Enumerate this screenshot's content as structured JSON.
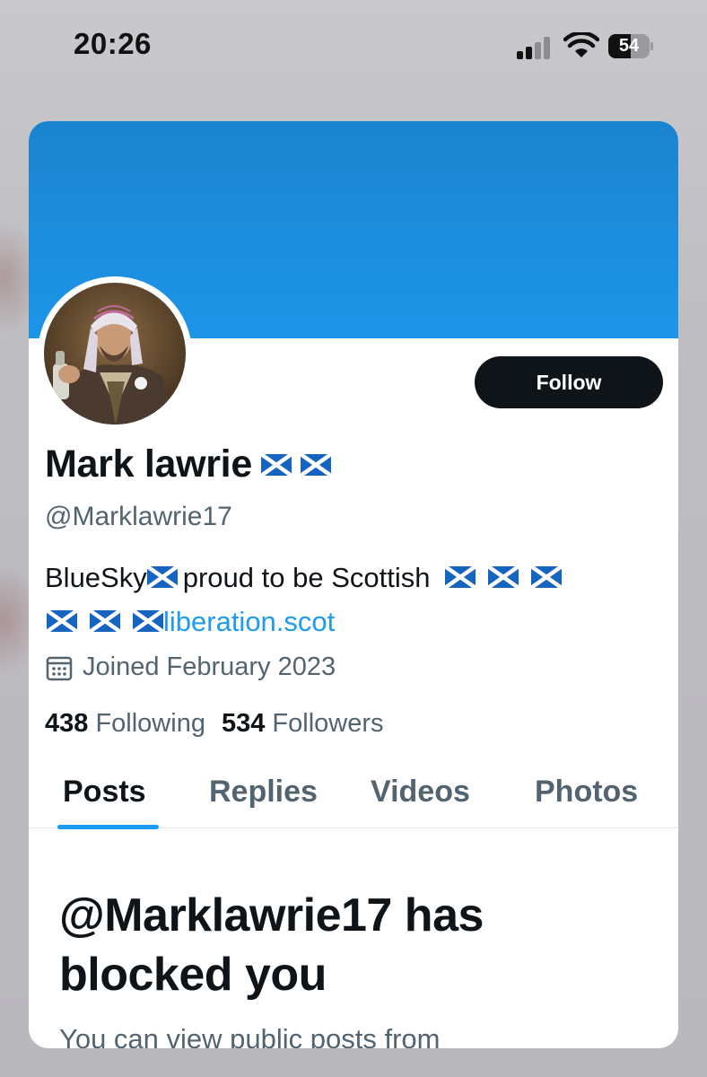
{
  "status_bar": {
    "time": "20:26",
    "battery": "54",
    "battery_level": 0.54,
    "icons": [
      "signal-icon",
      "wifi-icon",
      "battery-icon"
    ]
  },
  "profile": {
    "display_name": "Mark lawrie",
    "handle": "@Marklawrie17",
    "bio_text_1": "BlueSky",
    "bio_text_2": "proud to be Scottish",
    "bio_link": "liberation.scot",
    "joined": "Joined February 2023",
    "following_count": "438",
    "following_label": "Following",
    "followers_count": "534",
    "followers_label": "Followers",
    "follow_button": "Follow"
  },
  "tabs": [
    {
      "label": "Posts",
      "active": true
    },
    {
      "label": "Replies",
      "active": false
    },
    {
      "label": "Videos",
      "active": false
    },
    {
      "label": "Photos",
      "active": false
    }
  ],
  "blocked": {
    "title": "@Marklawrie17 has blocked you",
    "subtitle": "You can view public posts from"
  },
  "colors": {
    "banner": "#1d95e8",
    "accent": "#1d9bf0",
    "follow_button": "#0f1419",
    "secondary_text": "#536471"
  }
}
